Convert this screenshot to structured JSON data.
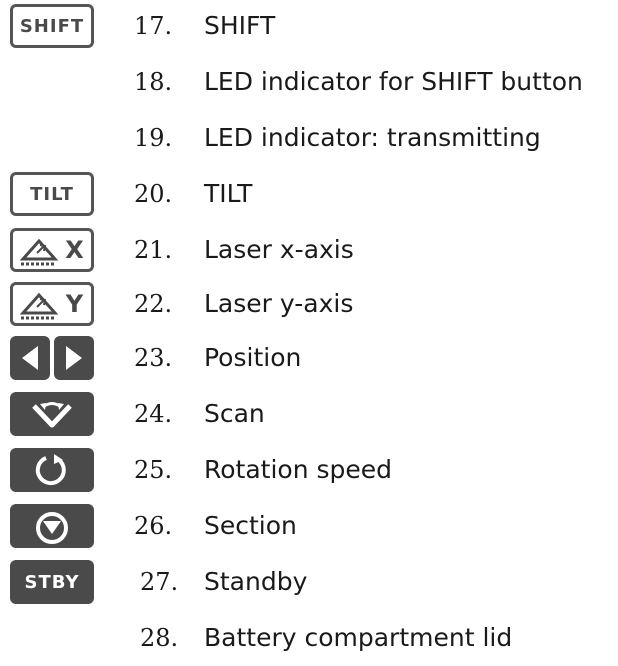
{
  "items": [
    {
      "number": "17.",
      "label": "SHIFT",
      "icon": "shift-key-icon",
      "icon_text": "SHIFT"
    },
    {
      "number": "18.",
      "label": "LED indicator for SHIFT button",
      "icon": ""
    },
    {
      "number": "19.",
      "label": "LED indicator: transmitting",
      "icon": ""
    },
    {
      "number": "20.",
      "label": "TILT",
      "icon": "tilt-key-icon",
      "icon_text": "TILT"
    },
    {
      "number": "21.",
      "label": "Laser x-axis",
      "icon": "laser-x-axis-key-icon",
      "icon_text": "X"
    },
    {
      "number": "22.",
      "label": "Laser y-axis",
      "icon": "laser-y-axis-key-icon",
      "icon_text": "Y"
    },
    {
      "number": "23.",
      "label": "Position",
      "icon": "position-arrows-key-icon"
    },
    {
      "number": "24.",
      "label": "Scan",
      "icon": "scan-key-icon"
    },
    {
      "number": "25.",
      "label": "Rotation speed",
      "icon": "rotation-speed-key-icon"
    },
    {
      "number": "26.",
      "label": "Section",
      "icon": "section-key-icon"
    },
    {
      "number": "27.",
      "label": "Standby",
      "icon": "standby-key-icon",
      "icon_text": "STBY"
    },
    {
      "number": "28.",
      "label": "Battery compartment lid",
      "icon": ""
    }
  ],
  "colors": {
    "icon_dark": "#4a4a4a",
    "icon_border": "#555555",
    "text": "#1a1a1a"
  }
}
